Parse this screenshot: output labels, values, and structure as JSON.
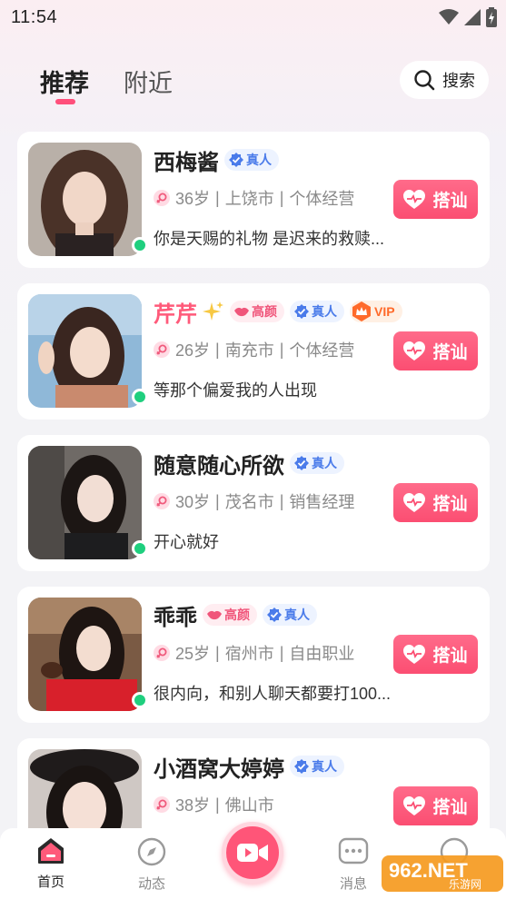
{
  "status": {
    "time": "11:54"
  },
  "tabs": [
    {
      "label": "推荐",
      "active": true
    },
    {
      "label": "附近",
      "active": false
    }
  ],
  "search": {
    "label": "搜索"
  },
  "profiles": [
    {
      "name": "西梅酱",
      "name_color": "default",
      "badges": [
        "真人"
      ],
      "age": "36岁",
      "city": "上饶市",
      "job": "个体经营",
      "bio": "你是天赐的礼物 是迟来的救赎...",
      "online": true,
      "action": "搭讪"
    },
    {
      "name": "芹芹",
      "name_color": "pink",
      "sparkle": true,
      "badges": [
        "高颜",
        "真人",
        "VIP"
      ],
      "age": "26岁",
      "city": "南充市",
      "job": "个体经营",
      "bio": "等那个偏爱我的人出现",
      "online": true,
      "action": "搭讪"
    },
    {
      "name": "随意随心所欲",
      "name_color": "default",
      "badges": [
        "真人"
      ],
      "age": "30岁",
      "city": "茂名市",
      "job": "销售经理",
      "bio": "开心就好",
      "online": true,
      "action": "搭讪"
    },
    {
      "name": "乖乖",
      "name_color": "default",
      "badges": [
        "高颜",
        "真人"
      ],
      "age": "25岁",
      "city": "宿州市",
      "job": "自由职业",
      "bio": "很内向，和别人聊天都要打100...",
      "online": true,
      "action": "搭讪"
    },
    {
      "name": "小酒窝大婷婷",
      "name_color": "default",
      "badges": [
        "真人"
      ],
      "age": "38岁",
      "city": "佛山市",
      "job": "",
      "bio": "",
      "online": false,
      "action": "搭讪"
    }
  ],
  "nav": [
    {
      "label": "首页",
      "icon": "home-icon",
      "active": true
    },
    {
      "label": "动态",
      "icon": "compass-icon",
      "active": false
    },
    {
      "label": "",
      "icon": "video-camera-icon",
      "active": false
    },
    {
      "label": "消息",
      "icon": "message-icon",
      "active": false
    }
  ],
  "watermark": {
    "text": "962.NET",
    "sub": "乐游网"
  },
  "colors": {
    "accent": "#ff5578",
    "verified": "#4a7bea",
    "online": "#1fcf7e"
  }
}
